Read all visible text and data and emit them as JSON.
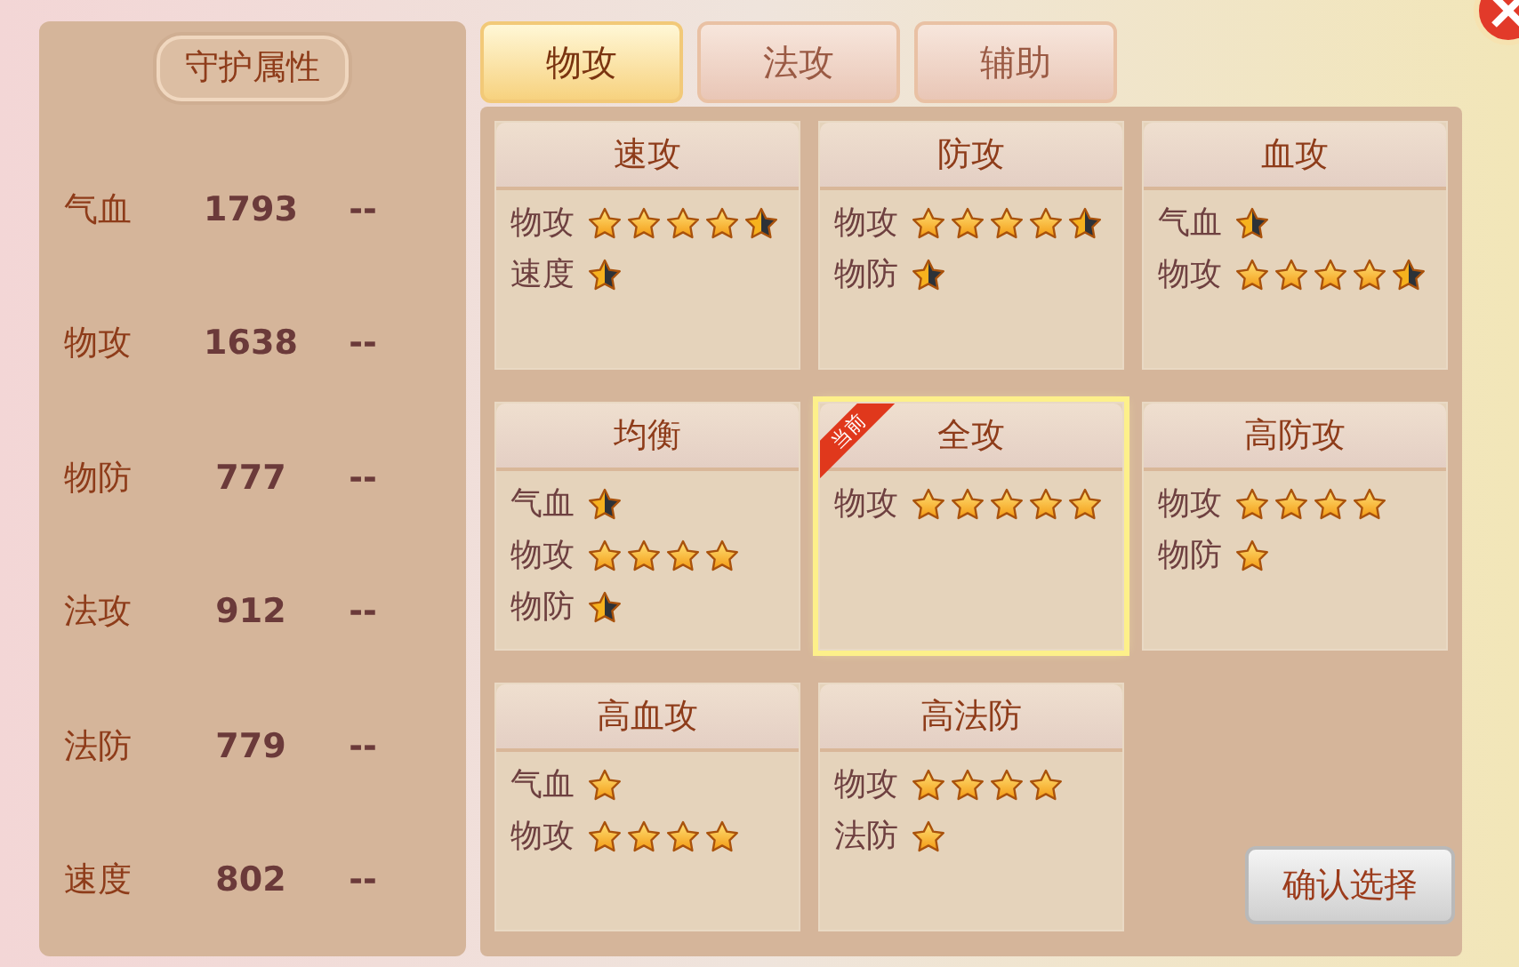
{
  "attributes": {
    "title": "守护属性",
    "rows": [
      {
        "label": "气血",
        "value": "1793",
        "change": "--"
      },
      {
        "label": "物攻",
        "value": "1638",
        "change": "--"
      },
      {
        "label": "物防",
        "value": "777",
        "change": "--"
      },
      {
        "label": "法攻",
        "value": "912",
        "change": "--"
      },
      {
        "label": "法防",
        "value": "779",
        "change": "--"
      },
      {
        "label": "速度",
        "value": "802",
        "change": "--"
      }
    ]
  },
  "tabs": [
    {
      "label": "物攻",
      "selected": true
    },
    {
      "label": "法攻",
      "selected": false
    },
    {
      "label": "辅助",
      "selected": false
    }
  ],
  "cards": [
    {
      "title": "速攻",
      "selected": false,
      "stats": [
        {
          "label": "物攻",
          "stars": 4.5
        },
        {
          "label": "速度",
          "stars": 0.5
        }
      ]
    },
    {
      "title": "防攻",
      "selected": false,
      "stats": [
        {
          "label": "物攻",
          "stars": 4.5
        },
        {
          "label": "物防",
          "stars": 0.5
        }
      ]
    },
    {
      "title": "血攻",
      "selected": false,
      "stats": [
        {
          "label": "气血",
          "stars": 0.5
        },
        {
          "label": "物攻",
          "stars": 4.5
        }
      ]
    },
    {
      "title": "均衡",
      "selected": false,
      "stats": [
        {
          "label": "气血",
          "stars": 0.5
        },
        {
          "label": "物攻",
          "stars": 4
        },
        {
          "label": "物防",
          "stars": 0.5
        }
      ]
    },
    {
      "title": "全攻",
      "selected": true,
      "badge": "当前",
      "stats": [
        {
          "label": "物攻",
          "stars": 5
        }
      ]
    },
    {
      "title": "高防攻",
      "selected": false,
      "stats": [
        {
          "label": "物攻",
          "stars": 4
        },
        {
          "label": "物防",
          "stars": 1
        }
      ]
    },
    {
      "title": "高血攻",
      "selected": false,
      "stats": [
        {
          "label": "气血",
          "stars": 1
        },
        {
          "label": "物攻",
          "stars": 4
        }
      ]
    },
    {
      "title": "高法防",
      "selected": false,
      "stats": [
        {
          "label": "物攻",
          "stars": 4
        },
        {
          "label": "法防",
          "stars": 1
        }
      ]
    }
  ],
  "confirm_button": "确认选择"
}
